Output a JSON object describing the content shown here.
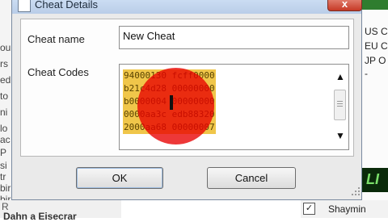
{
  "dialog": {
    "title": "Cheat Details",
    "close_label": "x",
    "cheat_name_label": "Cheat name",
    "cheat_name_value": "New Cheat",
    "cheat_codes_label": "Cheat Codes",
    "codes": [
      "94000130 fcff0000",
      "b21c4d28 00000000",
      "b0000004 00000000",
      "0000aa3c edb88320",
      "2000aa68 00000007"
    ],
    "ok_label": "OK",
    "cancel_label": "Cancel"
  },
  "background": {
    "left_fragments": [
      "ou",
      "rs",
      "ed",
      "to",
      "ni",
      "lo",
      "ac",
      "P",
      "si",
      "tr",
      "bir",
      "bir"
    ],
    "bottom_left_top": "R",
    "bottom_left_bottom": "Dahn a Eisecrar",
    "right_fragments": [
      "US C",
      "EU C",
      "JP O",
      "-"
    ],
    "right_banner": "LI",
    "bottom_right_check": "✓",
    "bottom_right_label": "Shaymin"
  },
  "colors": {
    "code_highlight": "#f0c64a",
    "red_marker": "#e80000",
    "close_button": "#c63a26",
    "title_bar": "#b9cde8"
  }
}
